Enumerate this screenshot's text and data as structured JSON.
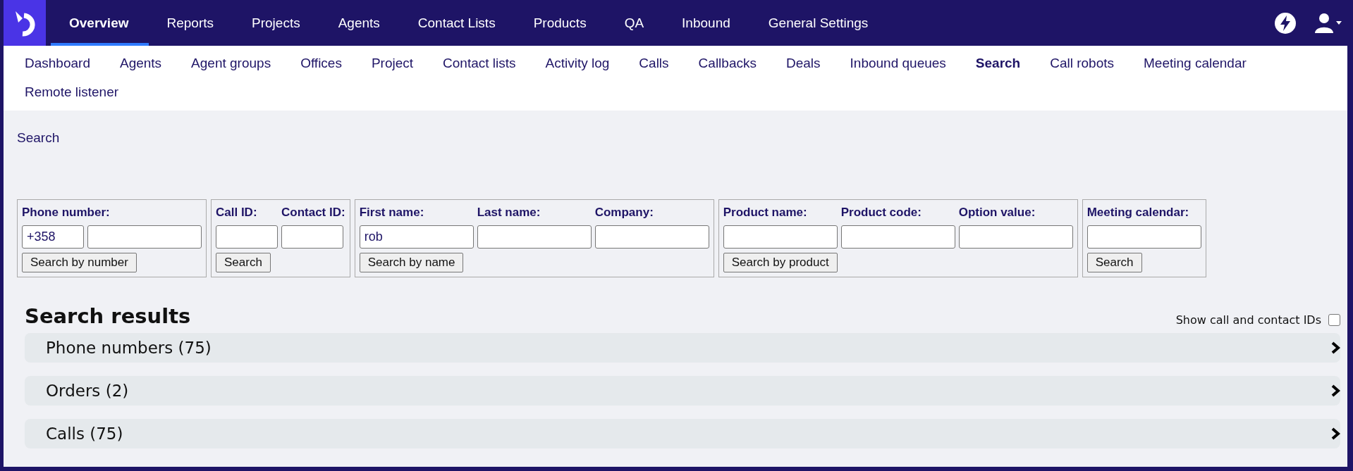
{
  "top_nav": [
    {
      "label": "Overview",
      "selected": true
    },
    {
      "label": "Reports",
      "selected": false
    },
    {
      "label": "Projects",
      "selected": false
    },
    {
      "label": "Agents",
      "selected": false
    },
    {
      "label": "Contact Lists",
      "selected": false
    },
    {
      "label": "Products",
      "selected": false
    },
    {
      "label": "QA",
      "selected": false
    },
    {
      "label": "Inbound",
      "selected": false
    },
    {
      "label": "General Settings",
      "selected": false
    }
  ],
  "sub_nav": [
    {
      "label": "Dashboard",
      "selected": false
    },
    {
      "label": "Agents",
      "selected": false
    },
    {
      "label": "Agent groups",
      "selected": false
    },
    {
      "label": "Offices",
      "selected": false
    },
    {
      "label": "Project",
      "selected": false
    },
    {
      "label": "Contact lists",
      "selected": false
    },
    {
      "label": "Activity log",
      "selected": false
    },
    {
      "label": "Calls",
      "selected": false
    },
    {
      "label": "Callbacks",
      "selected": false
    },
    {
      "label": "Deals",
      "selected": false
    },
    {
      "label": "Inbound queues",
      "selected": false
    },
    {
      "label": "Search",
      "selected": true
    },
    {
      "label": "Call robots",
      "selected": false
    },
    {
      "label": "Meeting calendar",
      "selected": false
    },
    {
      "label": "Remote listener",
      "selected": false
    }
  ],
  "page_title": "Search",
  "search_groups": [
    {
      "fields": [
        {
          "label": "Phone number:",
          "inputs": [
            {
              "kind": "short",
              "value": "+358"
            },
            {
              "kind": "long"
            }
          ]
        }
      ],
      "buttons": [
        "Search by number"
      ]
    },
    {
      "fields": [
        {
          "label": "Call ID:",
          "inputs": [
            {
              "kind": "short"
            }
          ]
        },
        {
          "label": "Contact ID:",
          "inputs": [
            {
              "kind": "short"
            }
          ]
        }
      ],
      "buttons": [
        "Search"
      ]
    },
    {
      "fields": [
        {
          "label": "First name:",
          "inputs": [
            {
              "kind": "long",
              "value": "rob"
            }
          ]
        },
        {
          "label": "Last name:",
          "inputs": [
            {
              "kind": "long"
            }
          ]
        },
        {
          "label": "Company:",
          "inputs": [
            {
              "kind": "long"
            }
          ]
        }
      ],
      "buttons": [
        "Search by name"
      ]
    },
    {
      "fields": [
        {
          "label": "Product name:",
          "inputs": [
            {
              "kind": "long"
            }
          ]
        },
        {
          "label": "Product code:",
          "inputs": [
            {
              "kind": "long"
            }
          ]
        },
        {
          "label": "Option value:",
          "inputs": [
            {
              "kind": "long"
            }
          ]
        }
      ],
      "buttons": [
        "Search by product"
      ]
    },
    {
      "fields": [
        {
          "label": "Meeting calendar:",
          "inputs": [
            {
              "kind": "long"
            }
          ]
        }
      ],
      "buttons": [
        "Search"
      ]
    }
  ],
  "results": {
    "title": "Search results",
    "toggle": {
      "label": "Show call and contact IDs",
      "checked": false
    },
    "sections": [
      {
        "label": "Phone numbers (75)",
        "expanded": false
      },
      {
        "label": "Orders (2)",
        "expanded": false
      },
      {
        "label": "Calls (75)",
        "expanded": false
      }
    ]
  }
}
